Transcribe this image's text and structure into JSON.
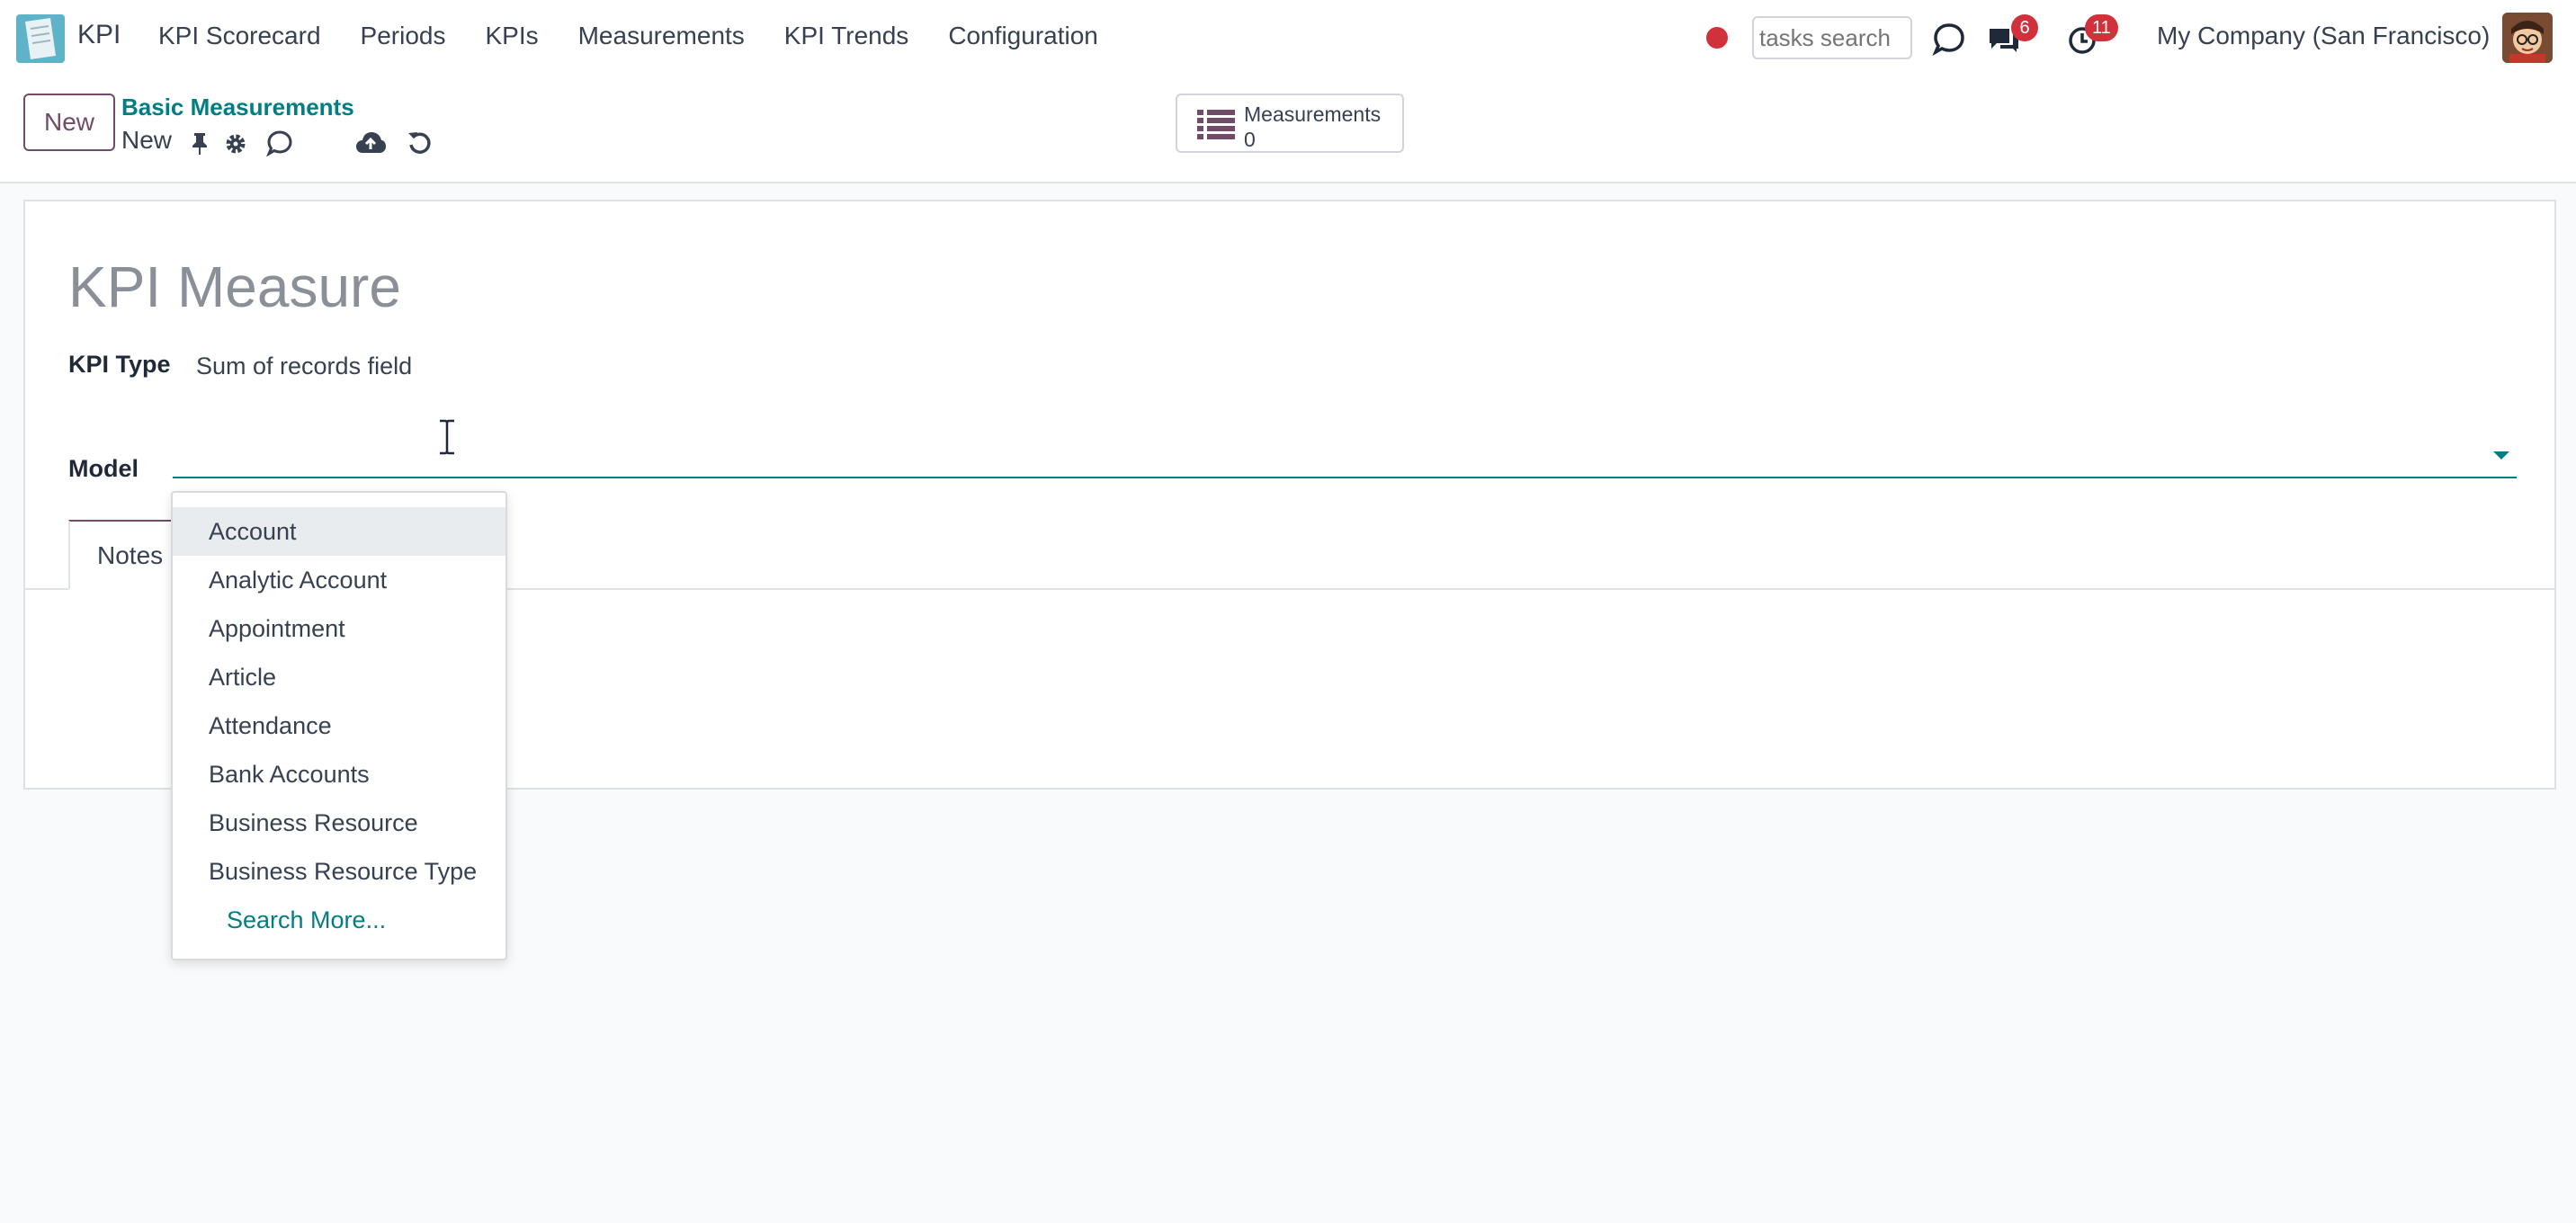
{
  "navbar": {
    "app_name": "KPI",
    "menu": [
      "KPI Scorecard",
      "Periods",
      "KPIs",
      "Measurements",
      "KPI Trends",
      "Configuration"
    ],
    "search_placeholder": "tasks search",
    "messages_count": "6",
    "activities_count": "11",
    "company": "My Company (San Francisco)"
  },
  "control_panel": {
    "new_button": "New",
    "breadcrumb_parent": "Basic Measurements",
    "breadcrumb_current": "New",
    "smart_button": {
      "label": "Measurements",
      "value": "0"
    }
  },
  "form": {
    "title_placeholder": "KPI Measure",
    "kpi_type_label": "KPI Type",
    "kpi_type_value": "Sum of records field",
    "model_label": "Model",
    "model_value": "",
    "tabs": [
      "Notes"
    ]
  },
  "dropdown": {
    "items": [
      "Account",
      "Analytic Account",
      "Appointment",
      "Article",
      "Attendance",
      "Bank Accounts",
      "Business Resource",
      "Business Resource Type"
    ],
    "search_more": "Search More..."
  },
  "colors": {
    "brand": "#714b67",
    "link": "#017e84",
    "badge": "#d0313a"
  }
}
